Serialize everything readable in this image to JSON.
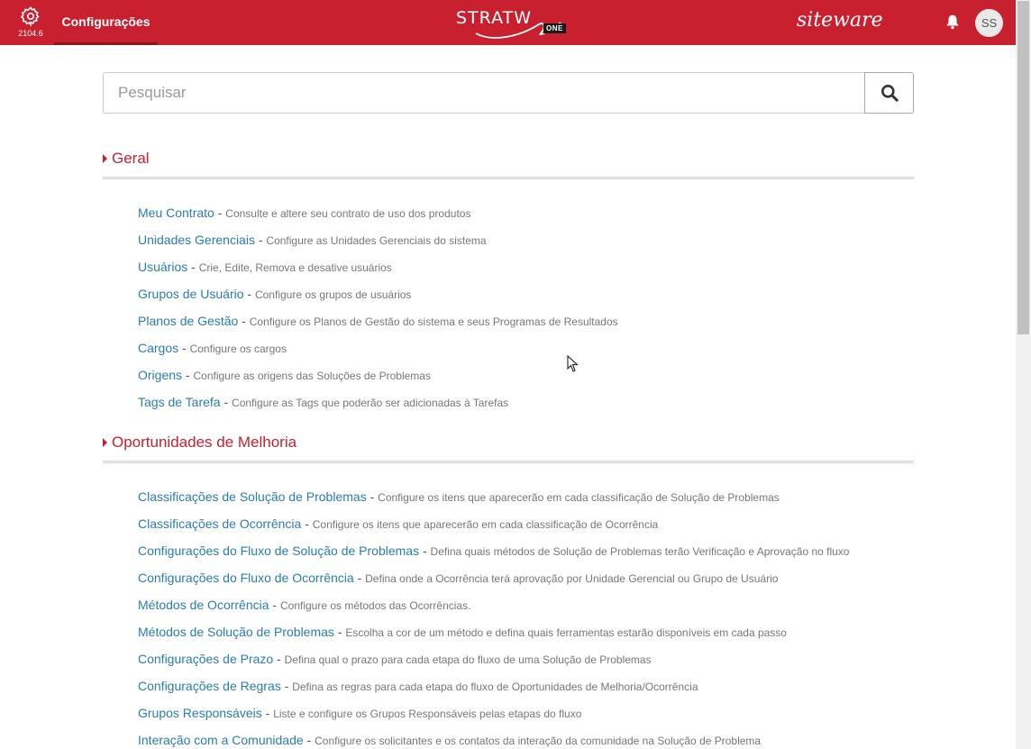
{
  "header": {
    "version": "2104.6",
    "tab_label": "Configurações",
    "product_name": "STRATW",
    "product_badge": "ONE",
    "brand": "siteware",
    "avatar_initials": "SS",
    "accent_color": "#c8202f"
  },
  "search": {
    "placeholder": "Pesquisar",
    "value": ""
  },
  "sections": [
    {
      "title": "Geral",
      "items": [
        {
          "label": "Meu Contrato",
          "desc": "Consulte e altere seu contrato de uso dos produtos"
        },
        {
          "label": "Unidades Gerenciais",
          "desc": "Configure as Unidades Gerenciais do sistema"
        },
        {
          "label": "Usuários",
          "desc": "Crie, Edite, Remova e desative usuários"
        },
        {
          "label": "Grupos de Usuário",
          "desc": "Configure os grupos de usuários"
        },
        {
          "label": "Planos de Gestão",
          "desc": "Configure os Planos de Gestão do sistema e seus Programas de Resultados"
        },
        {
          "label": "Cargos",
          "desc": "Configure os cargos"
        },
        {
          "label": "Origens",
          "desc": "Configure as origens das Soluções de Problemas"
        },
        {
          "label": "Tags de Tarefa",
          "desc": "Configure as Tags que poderão ser adicionadas à Tarefas"
        }
      ]
    },
    {
      "title": "Oportunidades de Melhoria",
      "items": [
        {
          "label": "Classificações de Solução de Problemas",
          "desc": "Configure os itens que aparecerão em cada classificação de Solução de Problemas"
        },
        {
          "label": "Classificações de Ocorrência",
          "desc": "Configure os itens que aparecerão em cada classificação de Ocorrência"
        },
        {
          "label": "Configurações do Fluxo de Solução de Problemas",
          "desc": "Defina quais métodos de Solução de Problemas terão Verificação e Aprovação no fluxo"
        },
        {
          "label": "Configurações do Fluxo de Ocorrência",
          "desc": "Defina onde a Ocorrência terá aprovação por Unidade Gerencial ou Grupo de Usuário"
        },
        {
          "label": "Métodos de Ocorrência",
          "desc": "Configure os métodos das Ocorrências."
        },
        {
          "label": "Métodos de Solução de Problemas",
          "desc": "Escolha a cor de um método e defina quais ferramentas estarão disponíveis em cada passo"
        },
        {
          "label": "Configurações de Prazo",
          "desc": "Defina qual o prazo para cada etapa do fluxo de uma Solução de Problemas"
        },
        {
          "label": "Configurações de Regras",
          "desc": "Defina as regras para cada etapa do fluxo de Oportunidades de Melhoria/Ocorrência"
        },
        {
          "label": "Grupos Responsáveis",
          "desc": "Liste e configure os Grupos Responsáveis pelas etapas do fluxo"
        },
        {
          "label": "Interação com a Comunidade",
          "desc": "Configure os solicitantes e os contatos da interação da comunidade na Solução de Problema"
        }
      ]
    }
  ]
}
